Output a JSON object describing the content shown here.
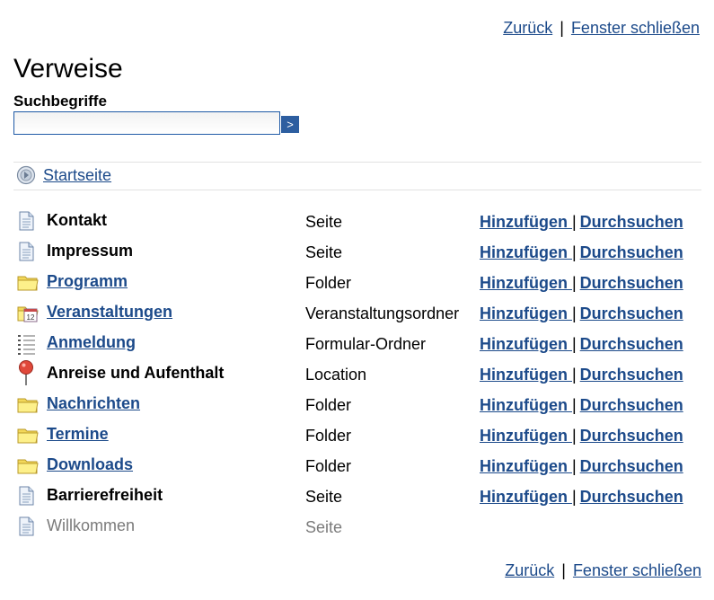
{
  "nav": {
    "back": "Zurück",
    "separator": "|",
    "close": "Fenster schließen"
  },
  "page": {
    "title": "Verweise",
    "search_label": "Suchbegriffe",
    "search_value": "",
    "search_button": ">"
  },
  "home": {
    "label": "Startseite",
    "icon": "home-icon"
  },
  "actions": {
    "add": "Hinzufügen ",
    "separator": "|",
    "browse": "Durchsuchen"
  },
  "items": [
    {
      "title": "Kontakt",
      "type": "Seite",
      "icon": "page-icon"
    },
    {
      "title": "Impressum",
      "type": "Seite",
      "icon": "page-icon"
    },
    {
      "title": "Programm",
      "type": "Folder",
      "icon": "folder-icon"
    },
    {
      "title": "Veranstaltungen",
      "type": "Veranstaltungsordner",
      "icon": "calendar-folder-icon"
    },
    {
      "title": "Anmeldung",
      "type": "Formular-Ordner",
      "icon": "form-list-icon"
    },
    {
      "title": "Anreise und Aufenthalt",
      "type": "Location",
      "icon": "map-pin-icon"
    },
    {
      "title": "Nachrichten",
      "type": "Folder",
      "icon": "folder-icon"
    },
    {
      "title": "Termine",
      "type": "Folder",
      "icon": "folder-icon"
    },
    {
      "title": "Downloads",
      "type": "Folder",
      "icon": "folder-icon"
    },
    {
      "title": "Barrierefreiheit",
      "type": "Seite",
      "icon": "page-icon"
    },
    {
      "title": "Willkommen",
      "type": "Seite",
      "icon": "page-icon"
    }
  ]
}
